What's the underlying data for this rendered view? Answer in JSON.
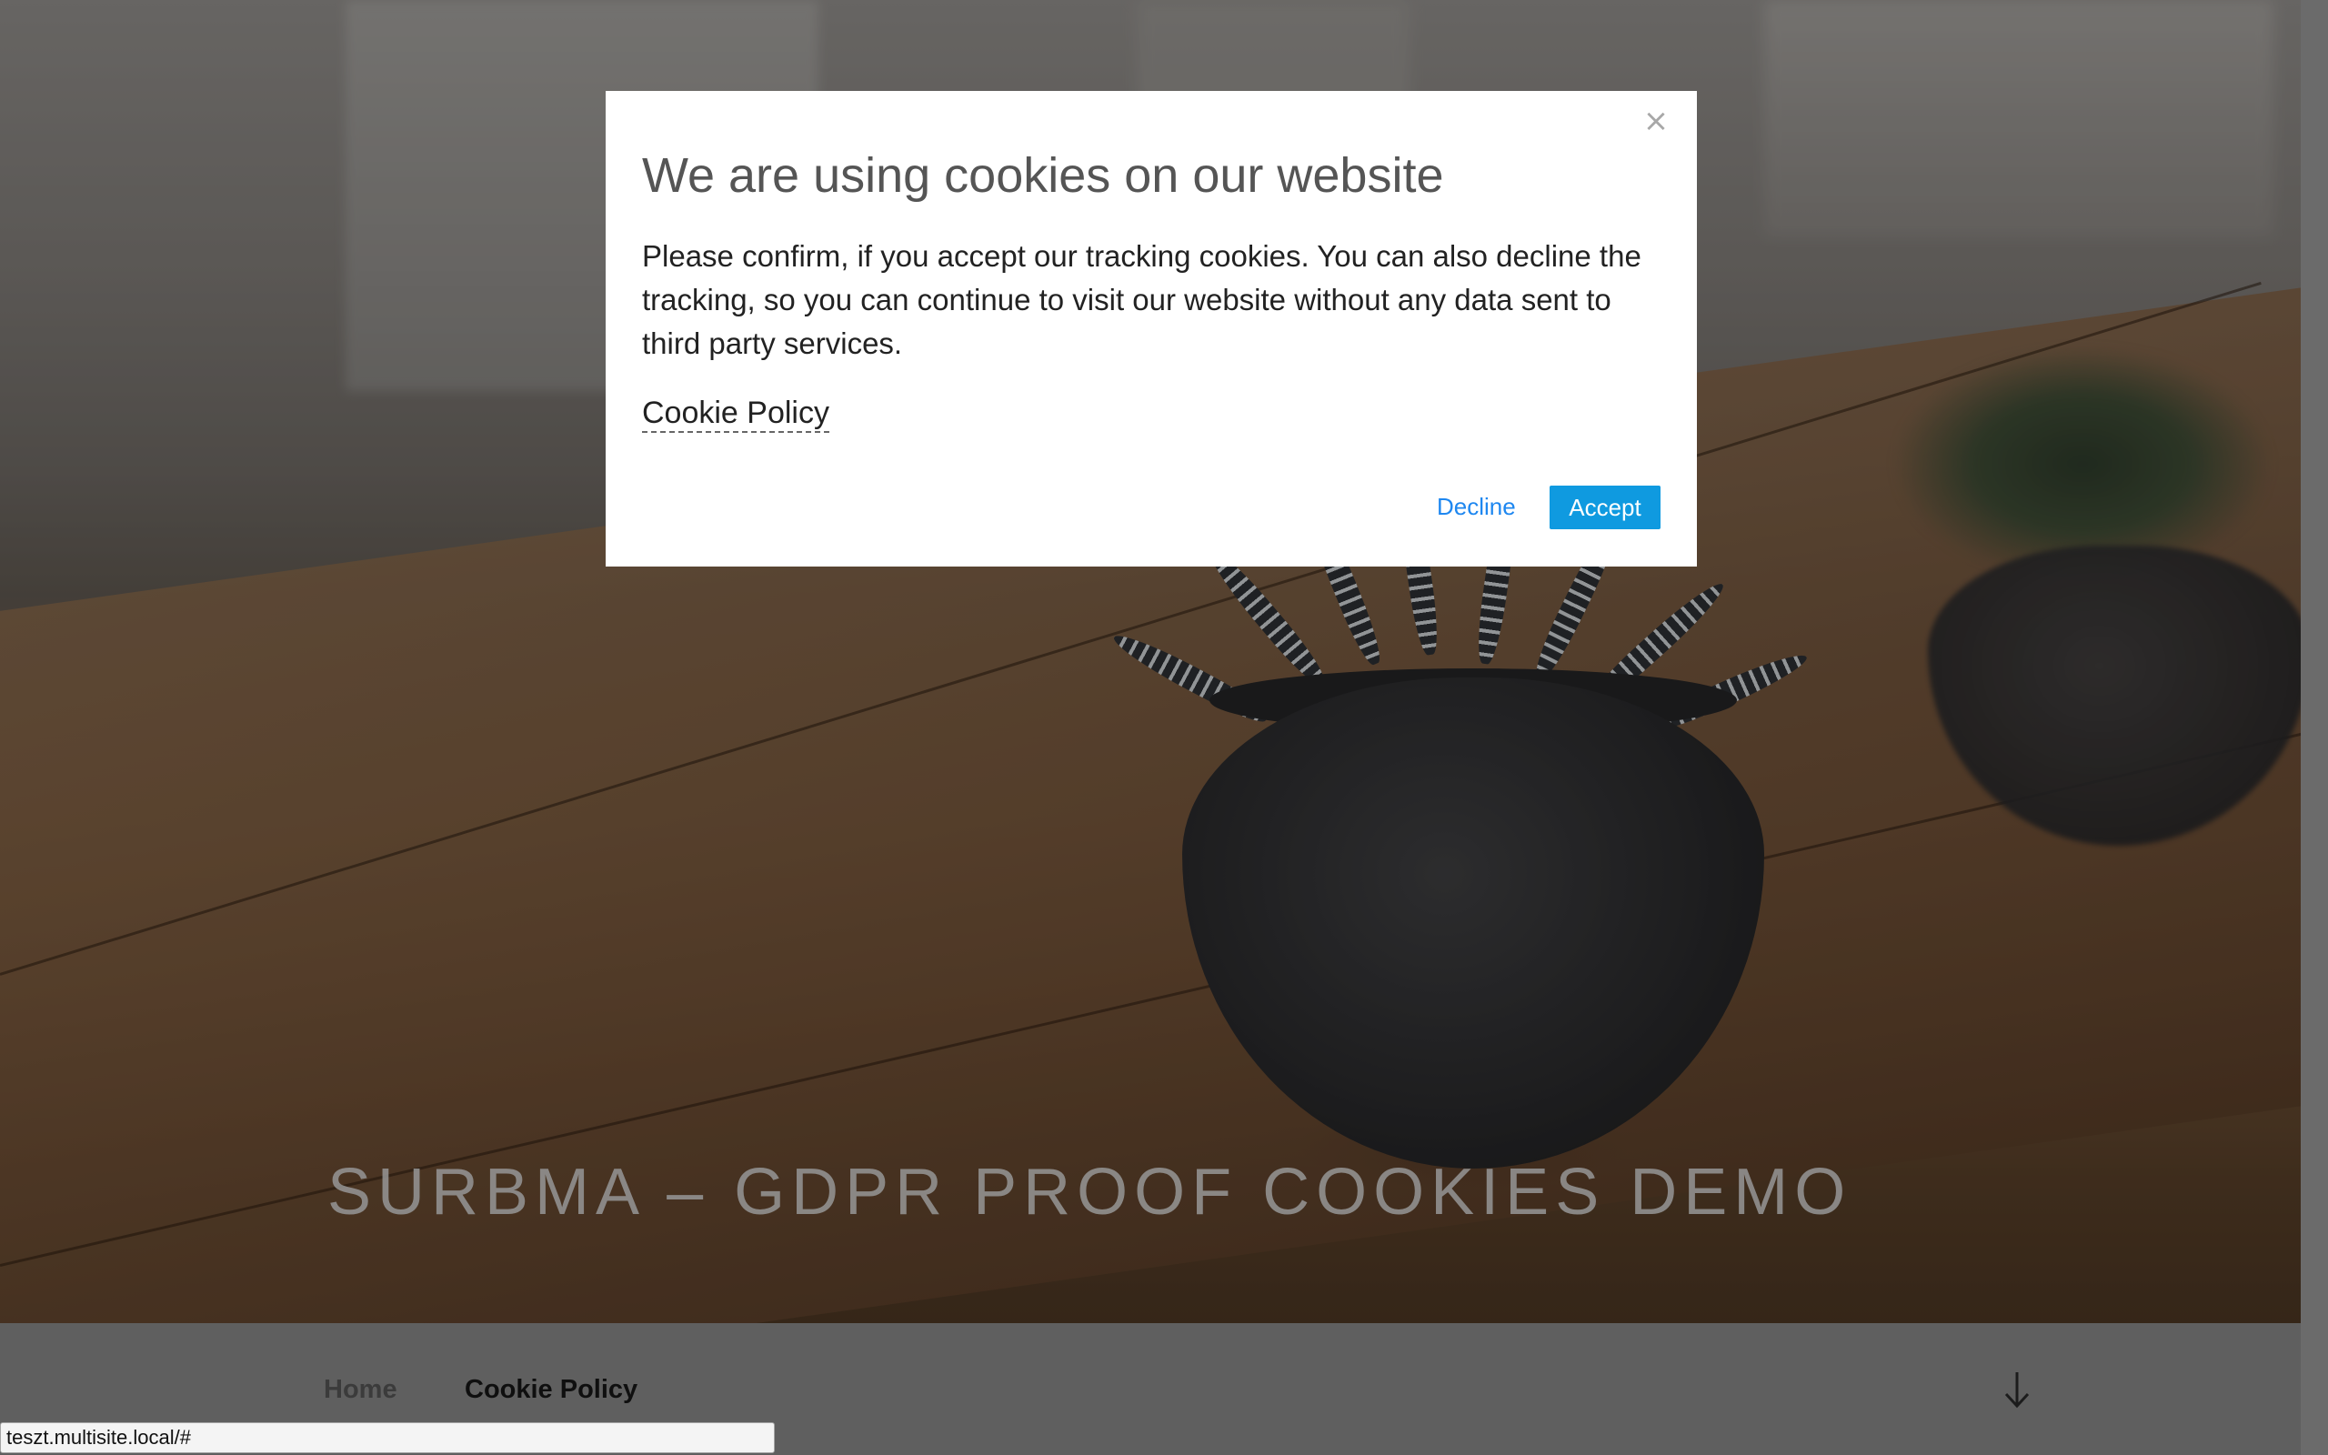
{
  "site": {
    "title": "SURBMA – GDPR PROOF COOKIES DEMO"
  },
  "navigation": {
    "items": [
      {
        "label": "Home"
      },
      {
        "label": "Cookie Policy"
      }
    ],
    "scroll_icon": "arrow-down-icon"
  },
  "cookie_modal": {
    "title": "We are using cookies on our website",
    "text": "Please confirm, if you accept our tracking cookies. You can also decline the tracking, so you can continue to visit our website without any data sent to third party services.",
    "policy_link": "Cookie Policy",
    "close_icon": "close-icon",
    "close_glyph": "×",
    "decline_label": "Decline",
    "accept_label": "Accept",
    "accent_color": "#0f9ae0"
  },
  "status_bar": {
    "url": "teszt.multisite.local/#"
  }
}
